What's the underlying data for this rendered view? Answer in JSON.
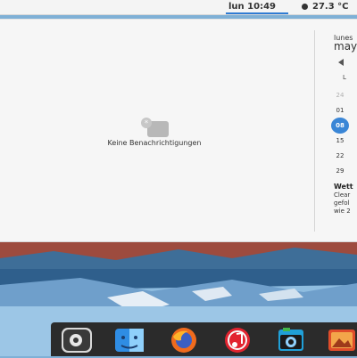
{
  "panel": {
    "clock": "lun 10:49",
    "temperature": "27.3 °C"
  },
  "notifications": {
    "empty_text": "Keine Benachrichtigungen"
  },
  "calendar": {
    "day_name": "lunes",
    "month": "may",
    "weekday_initial": "L",
    "numbers": [
      "24",
      "01",
      "08",
      "15",
      "22",
      "29"
    ],
    "today": "08"
  },
  "weather": {
    "title": "Wett",
    "line1": "Clear",
    "line2": "gefol",
    "line3": "wie 2"
  },
  "dock": {
    "apps": [
      {
        "name": "gimp",
        "icon": "gimp-icon"
      },
      {
        "name": "finder",
        "icon": "finder-icon"
      },
      {
        "name": "firefox",
        "icon": "firefox-icon"
      },
      {
        "name": "music",
        "icon": "music-icon"
      },
      {
        "name": "screenshot",
        "icon": "camera-icon"
      },
      {
        "name": "photos",
        "icon": "photos-icon"
      }
    ]
  },
  "colors": {
    "accent": "#3a86d6",
    "dock": "#2b2b2b",
    "popover": "#f6f6f6"
  }
}
